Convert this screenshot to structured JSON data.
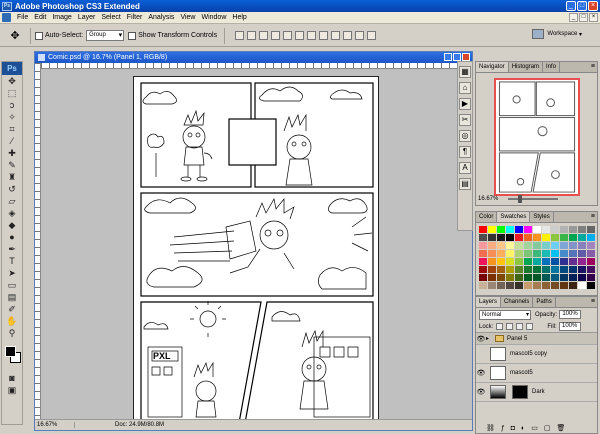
{
  "window": {
    "title": "Adobe Photoshop CS3 Extended",
    "app_badge": "Ps"
  },
  "menu": [
    "File",
    "Edit",
    "Image",
    "Layer",
    "Select",
    "Filter",
    "Analysis",
    "View",
    "Window",
    "Help"
  ],
  "options": {
    "auto_select_label": "Auto-Select:",
    "auto_select_value": "Group",
    "transform_label": "Show Transform Controls",
    "workspace_label": "Workspace"
  },
  "document": {
    "title": "Comic.psd @ 16.7% (Panel 1, RGB/8)",
    "zoom": "16.67%",
    "doc_info": "Doc: 24.9M/80.8M"
  },
  "navigator": {
    "tabs": [
      "Navigator",
      "Histogram",
      "Info"
    ],
    "zoom": "16.67%"
  },
  "swatches_panel": {
    "tabs": [
      "Color",
      "Swatches",
      "Styles"
    ],
    "colors": [
      "#ff0000",
      "#ffff00",
      "#00ff00",
      "#00ffff",
      "#0000ff",
      "#ff00ff",
      "#ffffff",
      "#e6e6e6",
      "#cccccc",
      "#b3b3b3",
      "#999999",
      "#808080",
      "#666666",
      "#4d4d4d",
      "#333333",
      "#1a1a1a",
      "#000000",
      "#ed1c24",
      "#f26522",
      "#f7941d",
      "#fff200",
      "#8dc63f",
      "#39b54a",
      "#00a651",
      "#00a99d",
      "#00aeef",
      "#f6989d",
      "#f9ad81",
      "#fdc68a",
      "#fff799",
      "#c4df9b",
      "#a3d39c",
      "#82ca9d",
      "#7bcdc8",
      "#6ecff6",
      "#7ea7d8",
      "#8393ca",
      "#8781bd",
      "#a187be",
      "#f26c4f",
      "#f68e56",
      "#fbaf5d",
      "#fff568",
      "#acd373",
      "#7cc576",
      "#3cb878",
      "#1cbbb4",
      "#00bff3",
      "#448ccb",
      "#5574b9",
      "#605ca8",
      "#855fa8",
      "#ed145b",
      "#f7941d",
      "#ffc20e",
      "#d7df23",
      "#8dc63f",
      "#00a651",
      "#00a99d",
      "#0072bc",
      "#0054a6",
      "#2e3192",
      "#662d91",
      "#92278f",
      "#9e005d",
      "#9e0b0f",
      "#a0410d",
      "#a36209",
      "#aba000",
      "#598527",
      "#1a7b30",
      "#007236",
      "#00746b",
      "#0076a3",
      "#004a80",
      "#003471",
      "#1b1464",
      "#440e62",
      "#790000",
      "#7b2e00",
      "#7d4900",
      "#827b00",
      "#406618",
      "#005e20",
      "#005826",
      "#005952",
      "#005b7f",
      "#003663",
      "#002157",
      "#0d004c",
      "#32004b",
      "#c7b299",
      "#998675",
      "#736357",
      "#534741",
      "#37302a",
      "#c69c6d",
      "#a67c52",
      "#8c6239",
      "#754c24",
      "#603913",
      "#3c2415",
      "#ffffff",
      "#000000"
    ]
  },
  "layers_panel": {
    "tabs": [
      "Layers",
      "Channels",
      "Paths"
    ],
    "blend_mode": "Normal",
    "opacity_label": "Opacity:",
    "opacity": "100%",
    "lock_label": "Lock:",
    "fill_label": "Fill:",
    "fill": "100%",
    "layers": [
      {
        "name": "Panel 5",
        "type": "group"
      },
      {
        "name": "mascot5 copy",
        "type": "layer"
      },
      {
        "name": "mascot5",
        "type": "layer"
      },
      {
        "name": "Dark",
        "type": "adjust"
      }
    ]
  }
}
